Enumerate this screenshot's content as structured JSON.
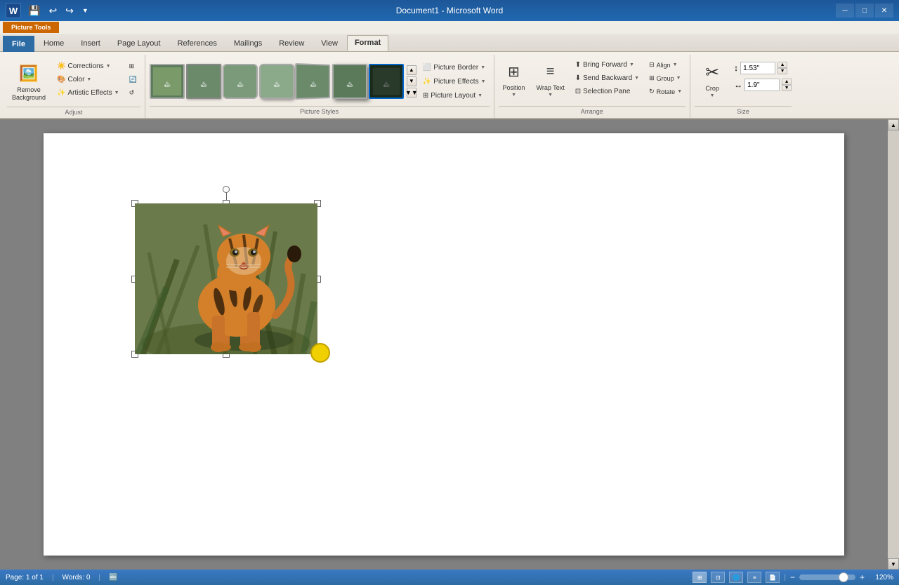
{
  "titlebar": {
    "app_name": "Document1 - Microsoft Word",
    "logo": "W",
    "minimize": "─",
    "maximize": "□",
    "close": "✕"
  },
  "ribbon_tabs": {
    "context_label": "Picture Tools",
    "tabs": [
      {
        "id": "file",
        "label": "File",
        "active": false
      },
      {
        "id": "home",
        "label": "Home",
        "active": false
      },
      {
        "id": "insert",
        "label": "Insert",
        "active": false
      },
      {
        "id": "page_layout",
        "label": "Page Layout",
        "active": false
      },
      {
        "id": "references",
        "label": "References",
        "active": false
      },
      {
        "id": "mailings",
        "label": "Mailings",
        "active": false
      },
      {
        "id": "review",
        "label": "Review",
        "active": false
      },
      {
        "id": "view",
        "label": "View",
        "active": false
      },
      {
        "id": "format",
        "label": "Format",
        "active": true
      }
    ]
  },
  "ribbon": {
    "adjust_group": {
      "label": "Adjust",
      "corrections_label": "Corrections",
      "color_label": "Color",
      "artistic_effects_label": "Artistic Effects",
      "remove_background_label": "Remove Background"
    },
    "picture_styles_group": {
      "label": "Picture Styles",
      "picture_border_label": "Picture Border",
      "picture_effects_label": "Picture Effects",
      "picture_layout_label": "Picture Layout"
    },
    "arrange_group": {
      "label": "Arrange",
      "position_label": "Position",
      "wrap_text_label": "Wrap Text",
      "bring_forward_label": "Bring Forward",
      "send_backward_label": "Send Backward",
      "selection_pane_label": "Selection Pane"
    },
    "size_group": {
      "label": "Size",
      "crop_label": "Crop",
      "height_label": "1.53\"",
      "width_label": "1.9\""
    }
  },
  "document": {
    "page_info": "Page: 1 of 1",
    "words_info": "Words: 0",
    "zoom_level": "120%"
  }
}
